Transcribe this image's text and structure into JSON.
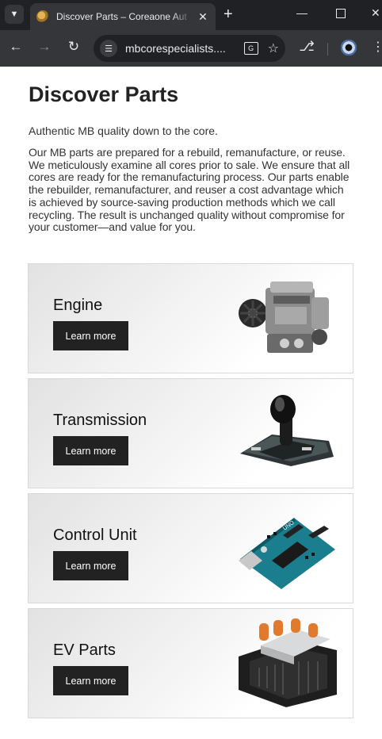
{
  "browser": {
    "tab_title": "Discover Parts – Coreaone Aut",
    "url": "mbcorespecialists....",
    "new_tab_label": "+",
    "icons": [
      "tab-search-icon",
      "favicon",
      "close-icon",
      "minimize-icon",
      "maximize-icon",
      "window-close-icon",
      "back-icon",
      "forward-icon",
      "reload-icon",
      "site-info-icon",
      "translate-icon",
      "star-icon",
      "extensions-icon",
      "profile-icon",
      "menu-icon"
    ]
  },
  "page": {
    "title": "Discover Parts",
    "tagline": "Authentic MB quality down to the core.",
    "description": "Our MB parts are prepared for a rebuild, remanufacture, or reuse. We meticulously examine all cores prior to sale. We ensure that all cores are ready for the remanufacturing process. Our parts enable the rebuilder, remanufacturer, and reuser a cost advantage which is achieved by source-saving production methods which we call recycling. The result is unchanged quality without compromise for your customer—and value for you."
  },
  "cards": [
    {
      "title": "Engine",
      "button": "Learn more",
      "image": "engine-image"
    },
    {
      "title": "Transmission",
      "button": "Learn more",
      "image": "gear-shifter-image"
    },
    {
      "title": "Control Unit",
      "button": "Learn more",
      "image": "circuit-board-image"
    },
    {
      "title": "EV Parts",
      "button": "Learn more",
      "image": "ev-battery-module-image"
    }
  ],
  "colors": {
    "tabbar": "#202124",
    "toolbar": "#35363a",
    "button": "#222222",
    "text": "#222222"
  }
}
